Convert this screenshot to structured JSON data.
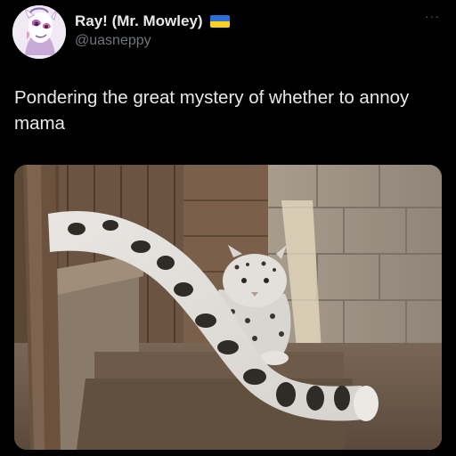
{
  "author": {
    "display_name": "Ray! (Mr. Mowley)",
    "handle": "@uasneppy",
    "avatar": "avatar-illustration",
    "badge": "ukraine-flag",
    "badge_colors": [
      "#2c6fd6",
      "#f7cf1c"
    ]
  },
  "menu": {
    "icon": "more-icon",
    "label": "···"
  },
  "tweet": {
    "text": "Pondering the great mystery of whether to annoy mama"
  },
  "media": {
    "type": "photo"
  },
  "theme": {
    "background": "#000000",
    "text": "#e7e9ea",
    "muted": "#71767b"
  }
}
